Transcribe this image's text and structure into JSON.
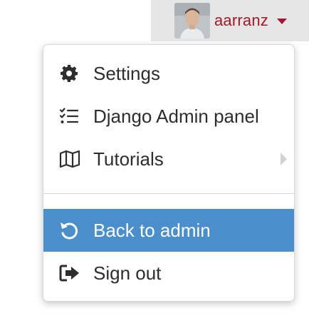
{
  "user": {
    "name": "aarranz"
  },
  "menu": {
    "items": [
      {
        "label": "Settings",
        "icon": "gear-icon"
      },
      {
        "label": "Django Admin panel",
        "icon": "tasks-list-icon"
      },
      {
        "label": "Tutorials",
        "icon": "map-icon",
        "has_submenu": true
      },
      {
        "label": "Back to admin",
        "icon": "undo-icon",
        "active": true
      },
      {
        "label": "Sign out",
        "icon": "sign-out-icon"
      }
    ]
  },
  "colors": {
    "accent_active": "#4a8fcb",
    "username": "#a3192b",
    "toggle_bg": "#e6e6e6"
  }
}
